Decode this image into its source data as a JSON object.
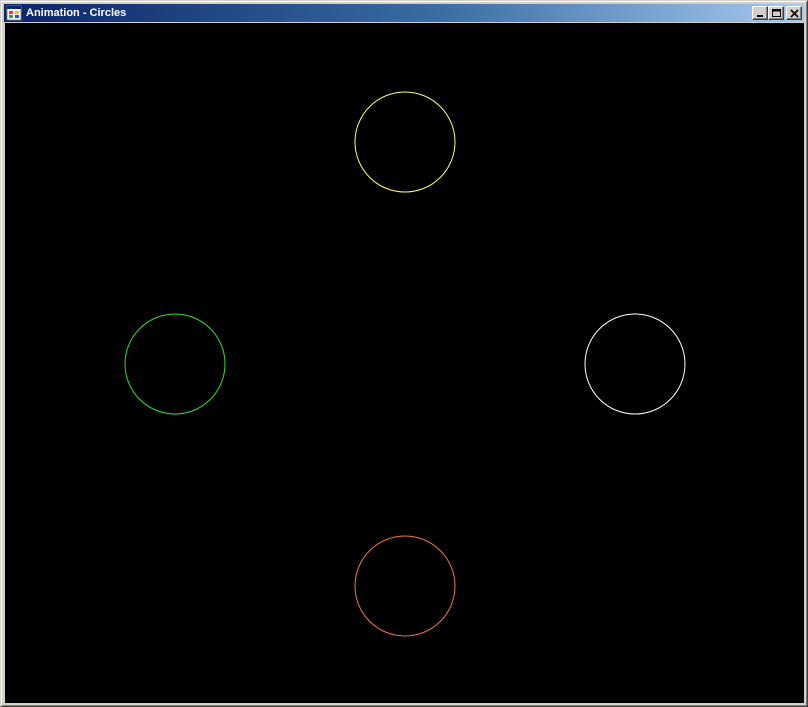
{
  "window": {
    "title": "Animation - Circles",
    "icon": "app-form-icon"
  },
  "caption_buttons": [
    {
      "name": "minimize",
      "icon": "minimize-icon"
    },
    {
      "name": "maximize",
      "icon": "maximize-icon"
    },
    {
      "name": "close",
      "icon": "close-icon"
    }
  ],
  "canvas": {
    "background": "#000000",
    "circles": [
      {
        "name": "yellow",
        "color": "#ffff66"
      },
      {
        "name": "green",
        "color": "#33dd33"
      },
      {
        "name": "white",
        "color": "#ffffff"
      },
      {
        "name": "orange",
        "color": "#ee7744"
      }
    ]
  }
}
